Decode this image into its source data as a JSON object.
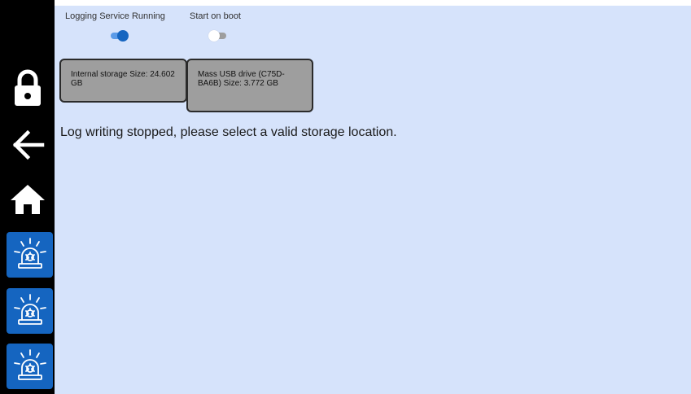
{
  "sidebar": {
    "items": [
      {
        "name": "lock",
        "icon": "lock-icon"
      },
      {
        "name": "back",
        "icon": "arrow-left-icon"
      },
      {
        "name": "home",
        "icon": "home-icon"
      },
      {
        "name": "alarm-1",
        "icon": "siren-icon"
      },
      {
        "name": "alarm-2",
        "icon": "siren-icon"
      },
      {
        "name": "alarm-3",
        "icon": "siren-icon"
      }
    ],
    "alarm_color": "#1565c0"
  },
  "toggles": {
    "logging": {
      "label": "Logging Service Running",
      "state": "on"
    },
    "boot": {
      "label": "Start on boot",
      "state": "off"
    }
  },
  "storage": [
    {
      "text": "Internal storage Size: 24.602 GB"
    },
    {
      "text": "Mass USB drive (C75D-BA6B) Size: 3.772 GB"
    }
  ],
  "status_message": "Log writing stopped, please select a valid storage location.",
  "colors": {
    "background": "#d6e3fb",
    "sidebar": "#000000",
    "accent": "#1565c0",
    "card": "#9e9e9e"
  }
}
